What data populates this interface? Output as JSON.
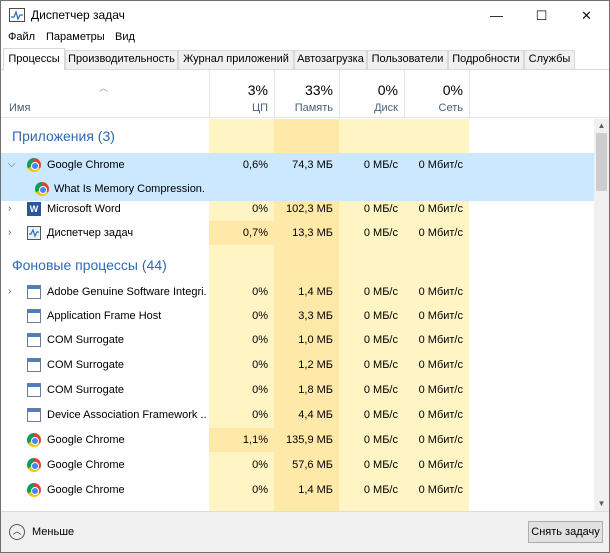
{
  "window": {
    "title": "Диспетчер задач",
    "icon": "task-manager-icon",
    "controls": {
      "minimize": "—",
      "maximize": "☐",
      "close": "✕"
    }
  },
  "menu": [
    {
      "label": "Файл"
    },
    {
      "label": "Параметры"
    },
    {
      "label": "Вид"
    }
  ],
  "tabs": [
    {
      "label": "Процессы",
      "active": true
    },
    {
      "label": "Производительность",
      "active": false
    },
    {
      "label": "Журнал приложений",
      "active": false
    },
    {
      "label": "Автозагрузка",
      "active": false
    },
    {
      "label": "Пользователи",
      "active": false
    },
    {
      "label": "Подробности",
      "active": false
    },
    {
      "label": "Службы",
      "active": false
    }
  ],
  "columns": {
    "name": {
      "label": "Имя"
    },
    "cpu": {
      "percent": "3%",
      "label": "ЦП"
    },
    "memory": {
      "percent": "33%",
      "label": "Память"
    },
    "disk": {
      "percent": "0%",
      "label": "Диск"
    },
    "network": {
      "percent": "0%",
      "label": "Сеть"
    }
  },
  "groups": {
    "apps": {
      "title": "Приложения (3)"
    },
    "background": {
      "title": "Фоновые процессы (44)"
    }
  },
  "rows": [
    {
      "name": "Google Chrome",
      "icon": "chrome-icon",
      "cpu": "0,6%",
      "memory": "74,3 МБ",
      "disk": "0 МБ/с",
      "network": "0 Мбит/с",
      "expanded": true,
      "selected": true
    },
    {
      "name": "What Is Memory Compression...",
      "icon": "chrome-icon",
      "child": true,
      "selected": true
    },
    {
      "name": "Microsoft Word",
      "icon": "word-icon",
      "cpu": "0%",
      "memory": "102,3 МБ",
      "disk": "0 МБ/с",
      "network": "0 Мбит/с"
    },
    {
      "name": "Диспетчер задач",
      "icon": "task-manager-icon",
      "cpu": "0,7%",
      "memory": "13,3 МБ",
      "disk": "0 МБ/с",
      "network": "0 Мбит/с"
    },
    {
      "name": "Adobe Genuine Software Integri...",
      "icon": "adobe-icon",
      "cpu": "0%",
      "memory": "1,4 МБ",
      "disk": "0 МБ/с",
      "network": "0 Мбит/с"
    },
    {
      "name": "Application Frame Host",
      "icon": "system-process-icon",
      "cpu": "0%",
      "memory": "3,3 МБ",
      "disk": "0 МБ/с",
      "network": "0 Мбит/с"
    },
    {
      "name": "COM Surrogate",
      "icon": "system-process-icon",
      "cpu": "0%",
      "memory": "1,0 МБ",
      "disk": "0 МБ/с",
      "network": "0 Мбит/с"
    },
    {
      "name": "COM Surrogate",
      "icon": "system-process-icon",
      "cpu": "0%",
      "memory": "1,2 МБ",
      "disk": "0 МБ/с",
      "network": "0 Мбит/с"
    },
    {
      "name": "COM Surrogate",
      "icon": "system-process-icon",
      "cpu": "0%",
      "memory": "1,8 МБ",
      "disk": "0 МБ/с",
      "network": "0 Мбит/с"
    },
    {
      "name": "Device Association Framework ...",
      "icon": "system-process-icon",
      "cpu": "0%",
      "memory": "4,4 МБ",
      "disk": "0 МБ/с",
      "network": "0 Мбит/с"
    },
    {
      "name": "Google Chrome",
      "icon": "chrome-icon",
      "cpu": "1,1%",
      "memory": "135,9 МБ",
      "disk": "0 МБ/с",
      "network": "0 Мбит/с"
    },
    {
      "name": "Google Chrome",
      "icon": "chrome-icon",
      "cpu": "0%",
      "memory": "57,6 МБ",
      "disk": "0 МБ/с",
      "network": "0 Мбит/с"
    },
    {
      "name": "Google Chrome",
      "icon": "chrome-icon",
      "cpu": "0%",
      "memory": "1,4 МБ",
      "disk": "0 МБ/с",
      "network": "0 Мбит/с"
    }
  ],
  "footer": {
    "less_label": "Меньше",
    "end_task_label": "Снять задачу"
  },
  "colors": {
    "heat_light": "#fff4c4",
    "heat_medium": "#ffe9a8",
    "selected_row": "#cce8ff",
    "group_title": "#2e6ab4"
  }
}
